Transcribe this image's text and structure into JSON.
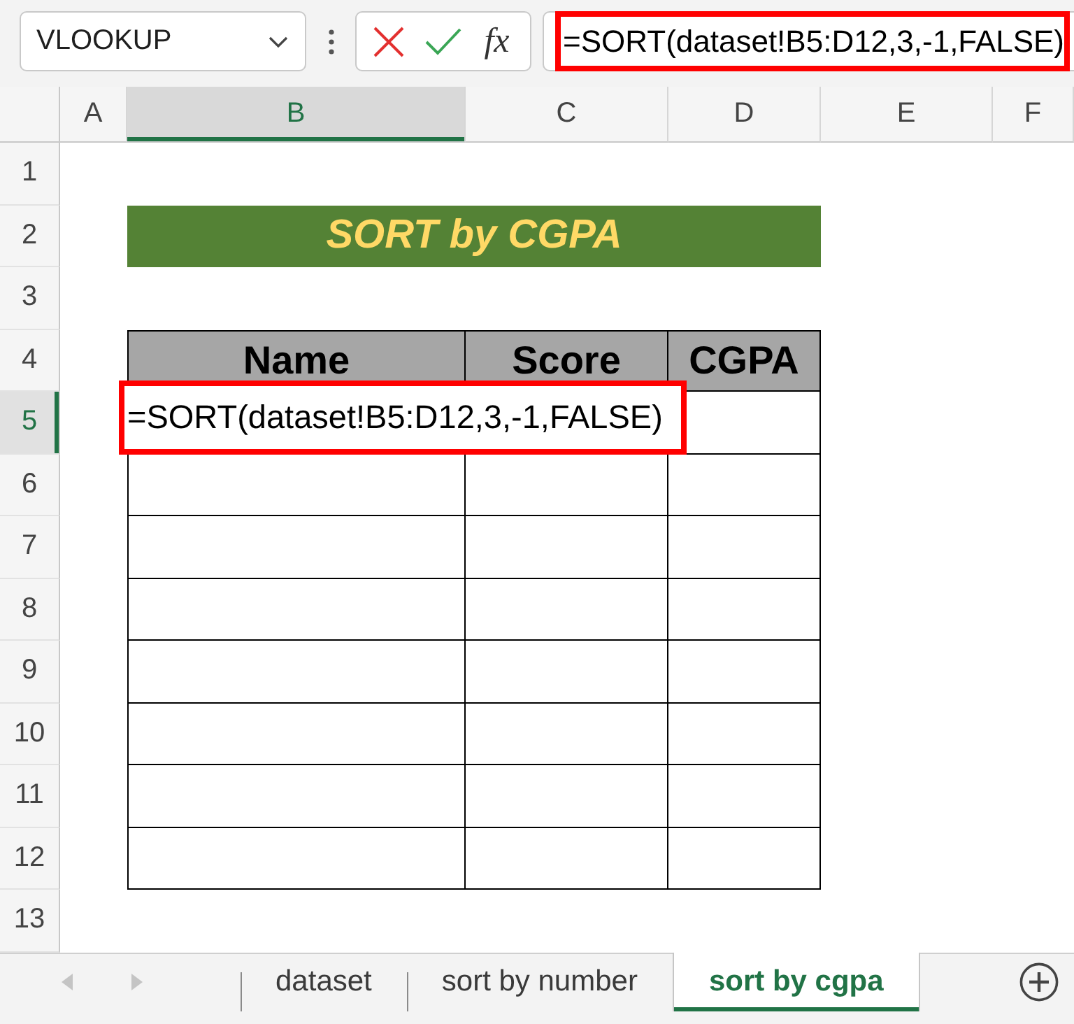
{
  "formula_bar": {
    "name_box": "VLOOKUP",
    "function_label": "fx",
    "formula": "=SORT(dataset!B5:D12,3,-1,FALSE)",
    "formula_highlighted": true
  },
  "columns": [
    {
      "label": "A",
      "selected": false
    },
    {
      "label": "B",
      "selected": true
    },
    {
      "label": "C",
      "selected": false
    },
    {
      "label": "D",
      "selected": false
    },
    {
      "label": "E",
      "selected": false
    },
    {
      "label": "F",
      "selected": false
    }
  ],
  "rows": [
    {
      "label": "1",
      "selected": false
    },
    {
      "label": "2",
      "selected": false
    },
    {
      "label": "3",
      "selected": false
    },
    {
      "label": "4",
      "selected": false
    },
    {
      "label": "5",
      "selected": true
    },
    {
      "label": "6",
      "selected": false
    },
    {
      "label": "7",
      "selected": false
    },
    {
      "label": "8",
      "selected": false
    },
    {
      "label": "9",
      "selected": false
    },
    {
      "label": "10",
      "selected": false
    },
    {
      "label": "11",
      "selected": false
    },
    {
      "label": "12",
      "selected": false
    },
    {
      "label": "13",
      "selected": false
    }
  ],
  "sheet": {
    "title": "SORT by CGPA",
    "table": {
      "headers": [
        "Name",
        "Score",
        "CGPA"
      ],
      "formula_cell": "=SORT(dataset!B5:D12,3,-1,FALSE)",
      "formula_cell_highlighted": true
    }
  },
  "sheet_tabs": [
    {
      "label": "dataset",
      "selected": false
    },
    {
      "label": "sort by number",
      "selected": false
    },
    {
      "label": "sort by cgpa",
      "selected": true
    }
  ]
}
